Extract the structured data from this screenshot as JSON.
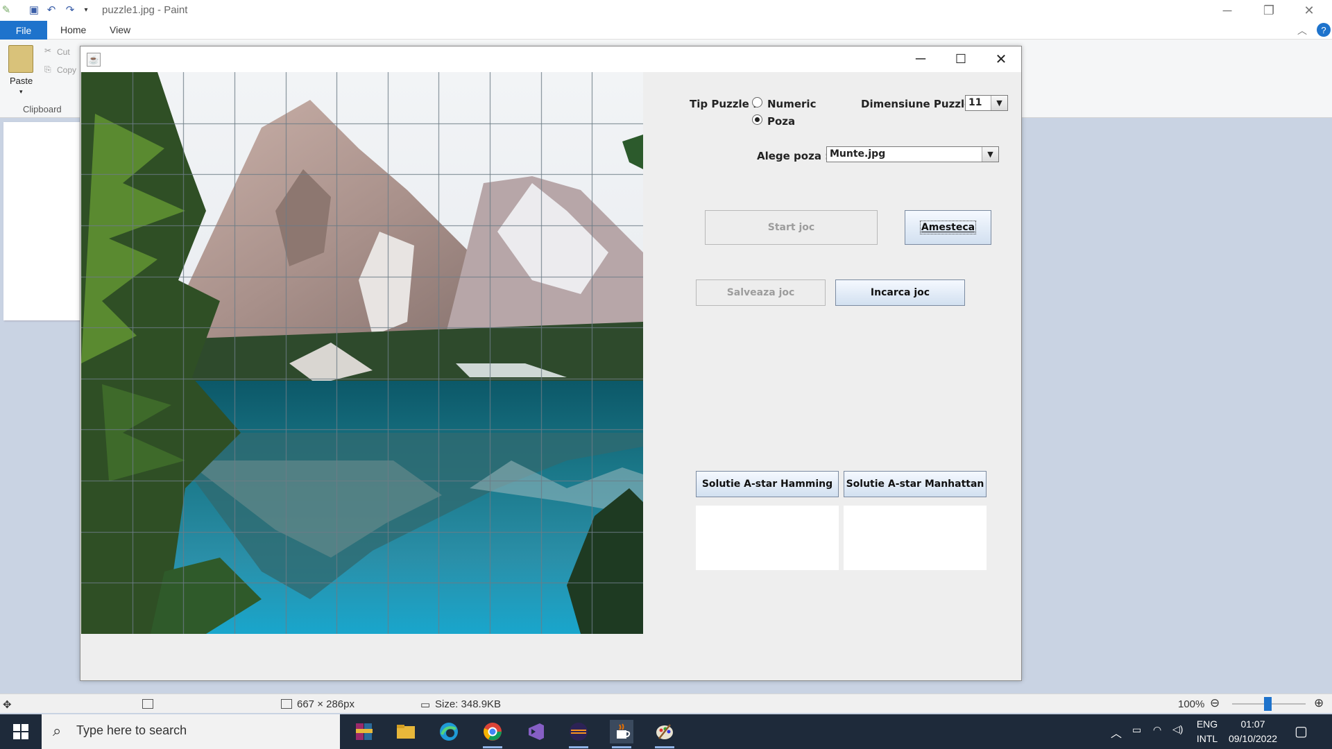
{
  "paint": {
    "title": "puzzle1.jpg - Paint",
    "tabs": [
      "File",
      "Home",
      "View"
    ],
    "clipboard": {
      "paste_label": "Paste",
      "cut_label": "Cut",
      "copy_label": "Copy",
      "group_label": "Clipboard"
    },
    "status": {
      "dimensions": "667 × 286px",
      "size": "Size: 348.9KB",
      "zoom": "100%"
    }
  },
  "app": {
    "tip_puzzle_label": "Tip Puzzle :",
    "radio_options": [
      "Numeric",
      "Poza"
    ],
    "selected_radio": "Poza",
    "dimensiune_label": "Dimensiune Puzzle :",
    "dimensiune_value": "11",
    "alege_poza_label": "Alege poza :",
    "alege_poza_value": "Munte.jpg",
    "buttons": {
      "start": "Start joc",
      "amesteca": "Amesteca",
      "salveaza": "Salveaza joc",
      "incarca": "Incarca joc",
      "hamming": "Solutie A-star Hamming",
      "manhattan": "Solutie A-star Manhattan"
    },
    "grid_size": 11
  },
  "taskbar": {
    "search_placeholder": "Type here to search",
    "lang_top": "ENG",
    "lang_bottom": "INTL",
    "time": "01:07",
    "date": "09/10/2022"
  },
  "colors": {
    "accent": "#1e73cc",
    "taskbar": "#1e2a3a",
    "button_top": "#f5f9ff",
    "button_bottom": "#d2e0f0"
  }
}
